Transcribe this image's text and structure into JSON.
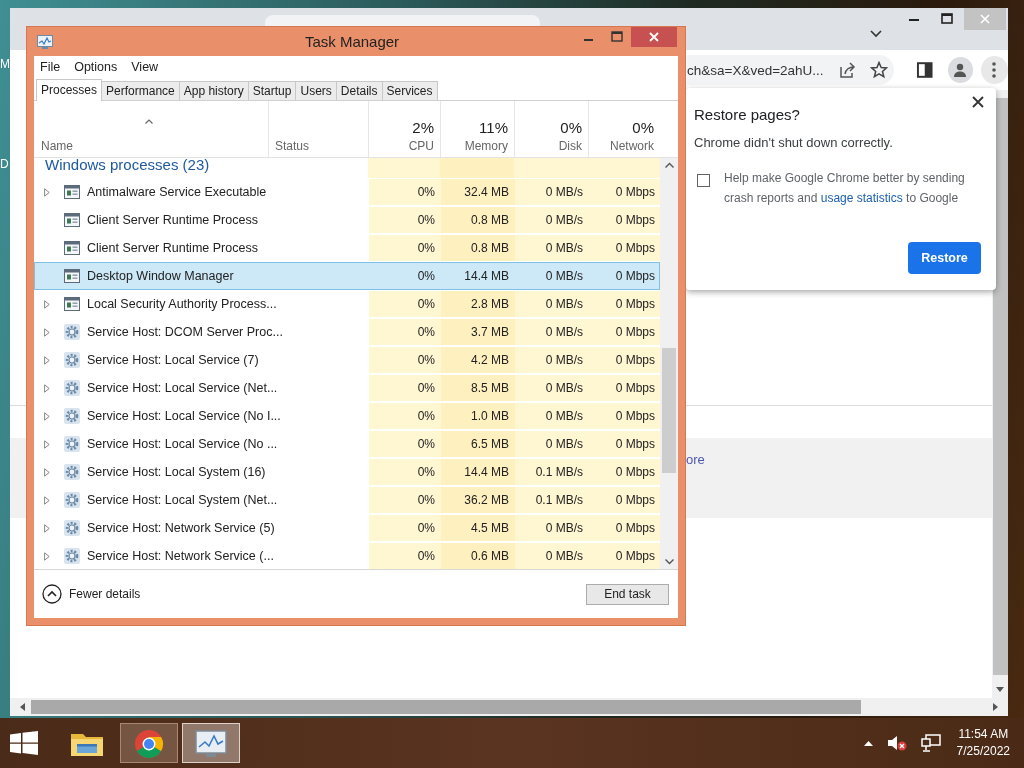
{
  "desktop": {
    "edge_letters": [
      "M",
      "D"
    ]
  },
  "browser": {
    "address": "ch&sa=X&ved=2ahU...",
    "page_link": "ore",
    "restore_dialog": {
      "title": "Restore pages?",
      "message": "Chrome didn't shut down correctly.",
      "checkbox": {
        "checked": false,
        "text_before": "Help make Google Chrome better by sending crash reports and ",
        "link": "usage statistics",
        "text_after": " to Google"
      },
      "button": "Restore"
    }
  },
  "task_manager": {
    "title": "Task Manager",
    "menu": [
      "File",
      "Options",
      "View"
    ],
    "tabs": [
      {
        "label": "Processes",
        "selected": true
      },
      {
        "label": "Performance",
        "selected": false
      },
      {
        "label": "App history",
        "selected": false
      },
      {
        "label": "Startup",
        "selected": false
      },
      {
        "label": "Users",
        "selected": false
      },
      {
        "label": "Details",
        "selected": false
      },
      {
        "label": "Services",
        "selected": false
      }
    ],
    "columns": [
      {
        "label": "Name"
      },
      {
        "label": "Status"
      },
      {
        "label": "CPU",
        "usage": "2%"
      },
      {
        "label": "Memory",
        "usage": "11%"
      },
      {
        "label": "Disk",
        "usage": "0%"
      },
      {
        "label": "Network",
        "usage": "0%"
      }
    ],
    "group": "Windows processes (23)",
    "rows": [
      {
        "name": "Antimalware Service Executable",
        "kind": "window",
        "expandable": true,
        "selected": false,
        "cpu": "0%",
        "memory": "32.4 MB",
        "disk": "0 MB/s",
        "network": "0 Mbps"
      },
      {
        "name": "Client Server Runtime Process",
        "kind": "window",
        "expandable": false,
        "selected": false,
        "cpu": "0%",
        "memory": "0.8 MB",
        "disk": "0 MB/s",
        "network": "0 Mbps"
      },
      {
        "name": "Client Server Runtime Process",
        "kind": "window",
        "expandable": false,
        "selected": false,
        "cpu": "0%",
        "memory": "0.8 MB",
        "disk": "0 MB/s",
        "network": "0 Mbps"
      },
      {
        "name": "Desktop Window Manager",
        "kind": "window",
        "expandable": false,
        "selected": true,
        "cpu": "0%",
        "memory": "14.4 MB",
        "disk": "0 MB/s",
        "network": "0 Mbps"
      },
      {
        "name": "Local Security Authority Process...",
        "kind": "window",
        "expandable": true,
        "selected": false,
        "cpu": "0%",
        "memory": "2.8 MB",
        "disk": "0 MB/s",
        "network": "0 Mbps"
      },
      {
        "name": "Service Host: DCOM Server Proc...",
        "kind": "gear",
        "expandable": true,
        "selected": false,
        "cpu": "0%",
        "memory": "3.7 MB",
        "disk": "0 MB/s",
        "network": "0 Mbps"
      },
      {
        "name": "Service Host: Local Service (7)",
        "kind": "gear",
        "expandable": true,
        "selected": false,
        "cpu": "0%",
        "memory": "4.2 MB",
        "disk": "0 MB/s",
        "network": "0 Mbps"
      },
      {
        "name": "Service Host: Local Service (Net...",
        "kind": "gear",
        "expandable": true,
        "selected": false,
        "cpu": "0%",
        "memory": "8.5 MB",
        "disk": "0 MB/s",
        "network": "0 Mbps"
      },
      {
        "name": "Service Host: Local Service (No I...",
        "kind": "gear",
        "expandable": true,
        "selected": false,
        "cpu": "0%",
        "memory": "1.0 MB",
        "disk": "0 MB/s",
        "network": "0 Mbps"
      },
      {
        "name": "Service Host: Local Service (No ...",
        "kind": "gear",
        "expandable": true,
        "selected": false,
        "cpu": "0%",
        "memory": "6.5 MB",
        "disk": "0 MB/s",
        "network": "0 Mbps"
      },
      {
        "name": "Service Host: Local System (16)",
        "kind": "gear",
        "expandable": true,
        "selected": false,
        "cpu": "0%",
        "memory": "14.4 MB",
        "disk": "0.1 MB/s",
        "network": "0 Mbps"
      },
      {
        "name": "Service Host: Local System (Net...",
        "kind": "gear",
        "expandable": true,
        "selected": false,
        "cpu": "0%",
        "memory": "36.2 MB",
        "disk": "0.1 MB/s",
        "network": "0 Mbps"
      },
      {
        "name": "Service Host: Network Service (5)",
        "kind": "gear",
        "expandable": true,
        "selected": false,
        "cpu": "0%",
        "memory": "4.5 MB",
        "disk": "0 MB/s",
        "network": "0 Mbps"
      },
      {
        "name": "Service Host: Network Service (...",
        "kind": "gear",
        "expandable": true,
        "selected": false,
        "cpu": "0%",
        "memory": "0.6 MB",
        "disk": "0 MB/s",
        "network": "0 Mbps"
      }
    ],
    "fewer_details": "Fewer details",
    "end_task": "End task"
  },
  "taskbar": {
    "apps": [
      {
        "kind": "explorer",
        "running": false
      },
      {
        "kind": "browser",
        "running": true
      },
      {
        "kind": "taskmanager",
        "running": true
      }
    ],
    "time": "11:54 AM",
    "date": "7/25/2022"
  }
}
